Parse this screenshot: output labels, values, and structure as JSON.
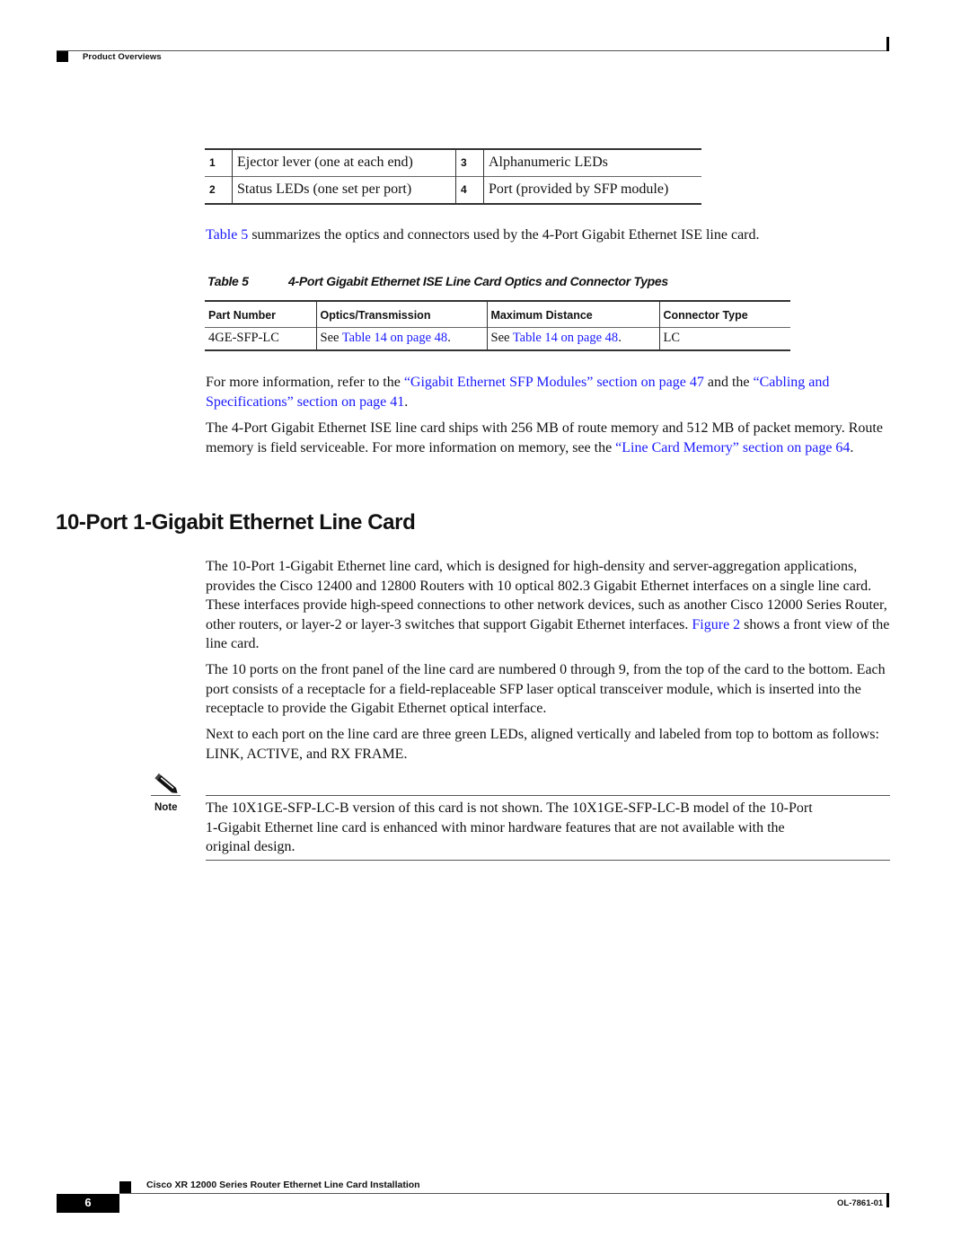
{
  "header": {
    "section": "Product Overviews"
  },
  "callout_table": {
    "rows": [
      {
        "num_a": "1",
        "desc_a": "Ejector lever (one at each end)",
        "num_b": "3",
        "desc_b": "Alphanumeric LEDs"
      },
      {
        "num_a": "2",
        "desc_a": "Status LEDs (one set per port)",
        "num_b": "4",
        "desc_b": "Port (provided by SFP module)"
      }
    ]
  },
  "intro_para": {
    "link": "Table 5",
    "text": " summarizes the optics and connectors used by the 4-Port Gigabit Ethernet ISE line card."
  },
  "table5": {
    "label": "Table 5",
    "caption": "4-Port Gigabit Ethernet ISE Line Card Optics and Connector Types",
    "headers": [
      "Part Number",
      "Optics/Transmission",
      "Maximum Distance",
      "Connector Type"
    ],
    "rows": [
      {
        "part_number": "4GE-SFP-LC",
        "optics_prefix": "See ",
        "optics_link": "Table 14 on page 48",
        "optics_suffix": ".",
        "distance_prefix": "See ",
        "distance_link": "Table 14 on page 48",
        "distance_suffix": ".",
        "connector": "LC"
      }
    ]
  },
  "more_info_para": {
    "t1": "For more information, refer to the ",
    "link1": "“Gigabit Ethernet SFP Modules” section on page 47",
    "t2": " and the ",
    "link2": "“Cabling and Specifications” section on page 41",
    "t3": "."
  },
  "memory_para": {
    "t1": "The 4-Port Gigabit Ethernet ISE line card ships with 256 MB of route memory and 512 MB of packet memory. Route memory is field serviceable. For more information on memory, see the ",
    "link": "“Line Card Memory” section on page 64",
    "t2": "."
  },
  "section": {
    "title": "10-Port 1-Gigabit Ethernet Line Card",
    "para1_t1": "The 10-Port 1-Gigabit Ethernet line card, which is designed for high-density and server-aggregation applications, provides the Cisco 12400 and 12800 Routers with 10 optical 802.3 Gigabit Ethernet interfaces on a single line card. These interfaces provide high-speed connections to other network devices, such as another Cisco 12000 Series Router, other routers, or layer-2 or layer-3 switches that support Gigabit Ethernet interfaces. ",
    "para1_link": "Figure 2",
    "para1_t2": " shows a front view of the line card.",
    "para2": "The 10 ports on the front panel of the line card are numbered 0 through 9, from the top of the card to the bottom. Each port consists of a receptacle for a field-replaceable SFP laser optical transceiver module, which is inserted into the receptacle to provide the Gigabit Ethernet optical interface.",
    "para3": "Next to each port on the line card are three green LEDs, aligned vertically and labeled from top to bottom as follows: LINK, ACTIVE, and RX FRAME."
  },
  "note": {
    "icon": "pencil-note-icon",
    "label": "Note",
    "text": "The 10X1GE-SFP-LC-B version of this card is not shown. The 10X1GE-SFP-LC-B model of the 10-Port 1-Gigabit Ethernet line card is enhanced with minor hardware features that are not available with the original design."
  },
  "footer": {
    "doc_title": "Cisco XR 12000 Series Router Ethernet Line Card Installation",
    "page_number": "6",
    "doc_number": "OL-7861-01"
  },
  "colors": {
    "link": "#1a1aff",
    "text": "#111111",
    "rule": "#555555"
  }
}
